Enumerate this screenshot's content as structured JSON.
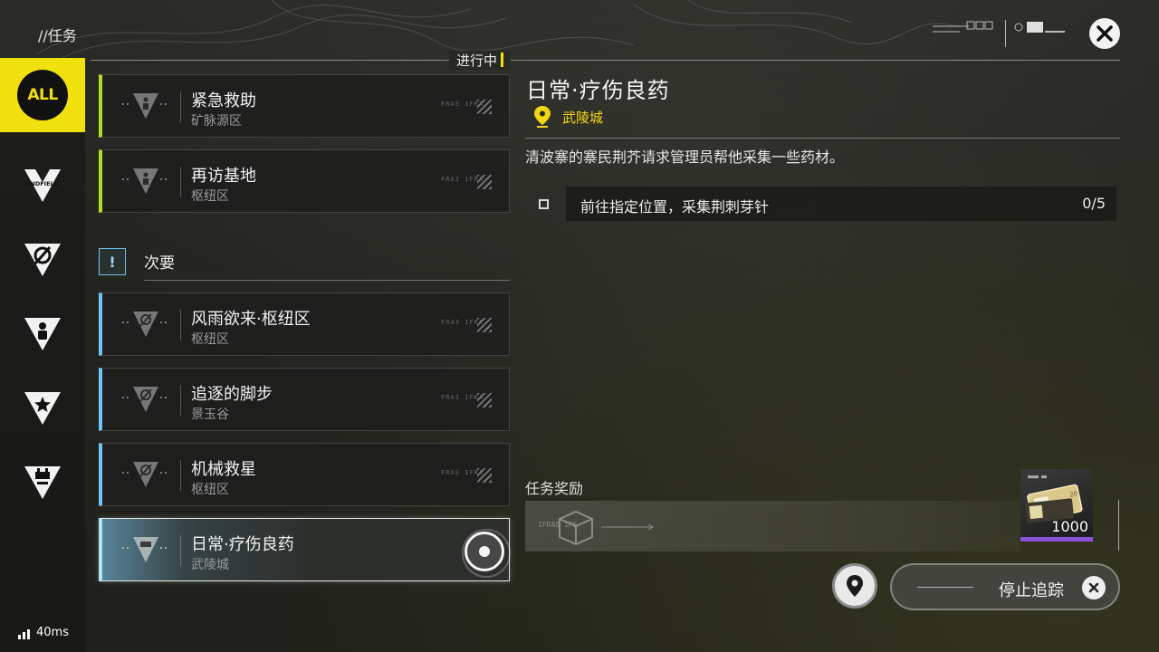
{
  "header": {
    "breadcrumb": "//任务"
  },
  "status_header": "进行中",
  "sidebar": {
    "categories": [
      {
        "id": "all",
        "label": "ALL",
        "active": true
      },
      {
        "id": "endfield",
        "label": "ENDFIELD",
        "icon": "endfield-icon"
      },
      {
        "id": "explore",
        "icon": "slash-circle-icon"
      },
      {
        "id": "character",
        "icon": "person-icon"
      },
      {
        "id": "star",
        "icon": "star-icon"
      },
      {
        "id": "facility",
        "icon": "battery-icon"
      }
    ]
  },
  "quests": {
    "main": [
      {
        "title": "紧急救助",
        "region": "矿脉源区",
        "code": "FRA3 1FRA"
      },
      {
        "title": "再访基地",
        "region": "枢纽区",
        "code": "FRA3 1FRA"
      }
    ],
    "secondary_label": "次要",
    "secondary_icon": "!",
    "secondary": [
      {
        "title": "风雨欲来·枢纽区",
        "region": "枢纽区",
        "code": "FRA3 1FRA"
      },
      {
        "title": "追逐的脚步",
        "region": "景玉谷",
        "code": "FRA3 1FRA"
      },
      {
        "title": "机械救星",
        "region": "枢纽区",
        "code": "FRA3 1FRA"
      },
      {
        "title": "日常·疗伤良药",
        "region": "武陵城",
        "code": "FRA3 1FRA",
        "selected": true
      }
    ]
  },
  "detail": {
    "title": "日常·疗伤良药",
    "location": "武陵城",
    "description": "清波寨的寨民荆芥请求管理员帮他采集一些药材。",
    "objective": {
      "text": "前往指定位置，采集荆刺芽针",
      "progress": "0/5"
    },
    "reward_label": "任务奖励",
    "reward_code": "1FRA8 1F5",
    "reward_item": {
      "quantity": "1000",
      "rarity_color": "#8a52d8"
    }
  },
  "actions": {
    "track_label": "停止追踪"
  },
  "network": {
    "ping": "40ms"
  },
  "colors": {
    "accent": "#f0e10e",
    "main_quest": "#b4dc2a",
    "side_quest": "#6fc6f2"
  }
}
